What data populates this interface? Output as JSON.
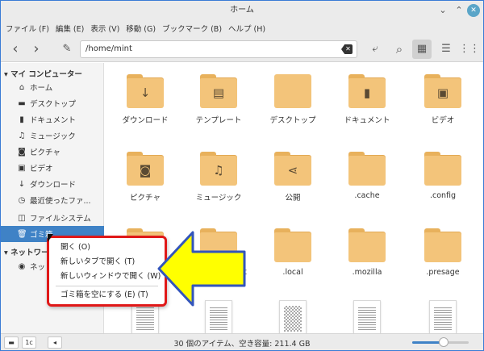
{
  "window": {
    "title": "ホーム",
    "minimize_glyph": "⌄",
    "maximize_glyph": "⌃",
    "close_glyph": "✕"
  },
  "menu": [
    "ファイル (F)",
    "編集 (E)",
    "表示 (V)",
    "移動 (G)",
    "ブックマーク (B)",
    "ヘルプ (H)"
  ],
  "toolbar": {
    "back_glyph": "‹",
    "forward_glyph": "›",
    "path_icon_glyph": "✎",
    "path": "/home/mint",
    "clear_glyph": "✕",
    "terminal_glyph": "⤶",
    "search_glyph": "⌕",
    "grid_glyph": "▦",
    "list_glyph": "☰",
    "compact_glyph": "⋮⋮"
  },
  "sidebar": {
    "section1": "▾ マイ コンピューター",
    "section2": "▾ ネットワーク",
    "items": [
      {
        "icon": "⌂",
        "label": "ホーム"
      },
      {
        "icon": "▬",
        "label": "デスクトップ"
      },
      {
        "icon": "▮",
        "label": "ドキュメント"
      },
      {
        "icon": "♫",
        "label": "ミュージック"
      },
      {
        "icon": "◙",
        "label": "ピクチャ"
      },
      {
        "icon": "▣",
        "label": "ビデオ"
      },
      {
        "icon": "↓",
        "label": "ダウンロード"
      },
      {
        "icon": "◷",
        "label": "最近使ったファ..."
      },
      {
        "icon": "◫",
        "label": "ファイルシステム"
      },
      {
        "icon": "🗑",
        "label": "ゴミ箱"
      },
      {
        "icon": "◉",
        "label": "ネットワーク"
      }
    ]
  },
  "files": [
    {
      "name": "ダウンロード",
      "glyph": "↓"
    },
    {
      "name": "テンプレート",
      "glyph": "▤"
    },
    {
      "name": "デスクトップ",
      "glyph": ""
    },
    {
      "name": "ドキュメント",
      "glyph": "▮"
    },
    {
      "name": "ビデオ",
      "glyph": "▣"
    },
    {
      "name": "ピクチャ",
      "glyph": "◙"
    },
    {
      "name": "ミュージック",
      "glyph": "♫"
    },
    {
      "name": "公開",
      "glyph": "⋖"
    },
    {
      "name": ".cache",
      "glyph": ""
    },
    {
      "name": ".config",
      "glyph": ""
    },
    {
      "name": "",
      "glyph": ""
    },
    {
      "name": "nt",
      "glyph": ""
    },
    {
      "name": ".local",
      "glyph": ""
    },
    {
      "name": ".mozilla",
      "glyph": ""
    },
    {
      "name": ".presage",
      "glyph": ""
    }
  ],
  "context_menu": {
    "items": [
      "開く (O)",
      "新しいタブで開く (T)",
      "新しいウィンドウで開く (W)",
      "ゴミ箱を空にする (E) (T)"
    ]
  },
  "statusbar": {
    "text": "30 個のアイテム、空き容量: 211.4 GB",
    "btn1": "▬",
    "btn2": "1c",
    "btn3": "◂",
    "zoom_level": 0.55
  },
  "colors": {
    "accent": "#3f82c6",
    "folder": "#f3c47a",
    "highlight_border": "#e01818",
    "arrow_fill": "#ffff00",
    "arrow_stroke": "#3355bb"
  }
}
